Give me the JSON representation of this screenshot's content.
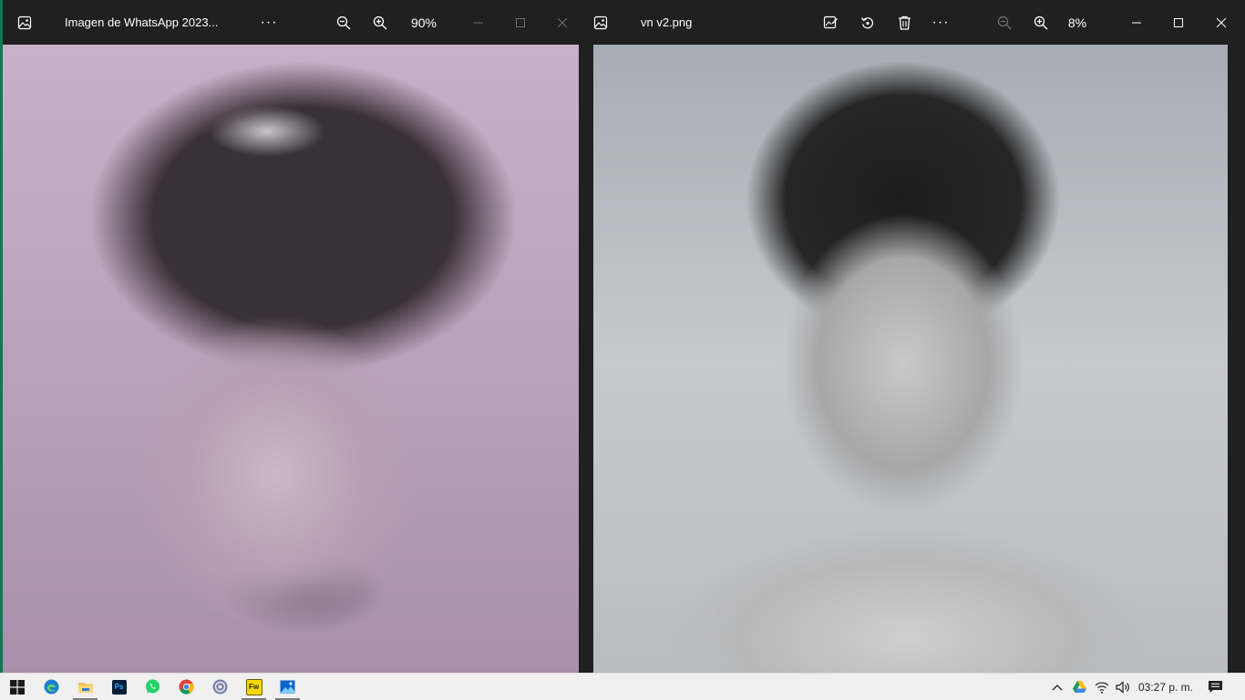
{
  "left_window": {
    "title": "Imagen de WhatsApp 2023...",
    "zoom": "90%",
    "icons": [
      "image-app-icon",
      "more-options-icon",
      "zoom-out-icon",
      "zoom-in-icon",
      "minimize-icon",
      "maximize-icon",
      "close-icon"
    ]
  },
  "right_window": {
    "title": "vn v2.png",
    "zoom": "8%",
    "icons": [
      "image-app-icon",
      "edit-image-icon",
      "rotate-icon",
      "delete-icon",
      "more-options-icon",
      "zoom-out-icon",
      "zoom-in-icon",
      "minimize-icon",
      "maximize-icon",
      "close-icon"
    ]
  },
  "taskbar": {
    "apps": [
      {
        "name": "start",
        "icon": "windows-logo-icon",
        "label": ""
      },
      {
        "name": "edge",
        "icon": "edge-icon",
        "label": ""
      },
      {
        "name": "file-explorer",
        "icon": "folder-icon",
        "label": ""
      },
      {
        "name": "photoshop",
        "icon": "photoshop-icon",
        "label": "Ps"
      },
      {
        "name": "whatsapp",
        "icon": "whatsapp-icon",
        "label": ""
      },
      {
        "name": "chrome",
        "icon": "chrome-icon",
        "label": ""
      },
      {
        "name": "browser",
        "icon": "browser-icon",
        "label": ""
      },
      {
        "name": "fireworks",
        "icon": "fireworks-icon",
        "label": "Fw"
      },
      {
        "name": "photos",
        "icon": "photos-icon",
        "label": ""
      }
    ],
    "clock": "03:27 p. m.",
    "tray_icons": [
      "chevron-up-icon",
      "google-drive-icon",
      "wifi-icon",
      "volume-icon",
      "notifications-icon"
    ]
  },
  "colors": {
    "window_bg": "#202020",
    "accent_border": "#0b7a55",
    "taskbar_bg": "#f0f0f0"
  }
}
